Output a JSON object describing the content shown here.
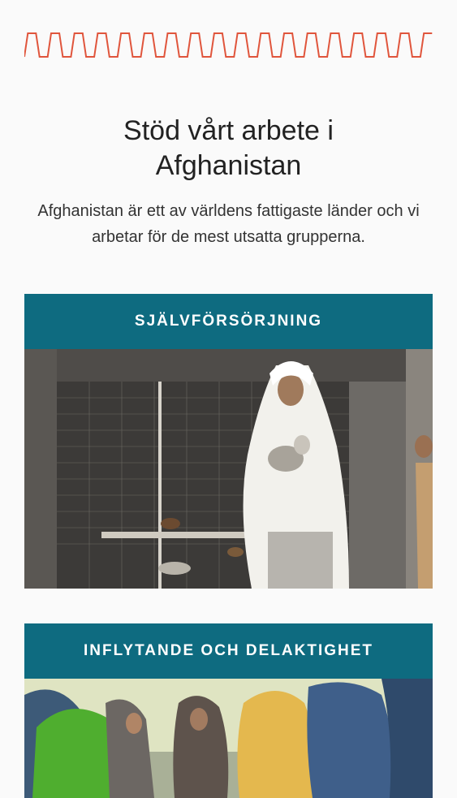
{
  "header": {
    "title_line1": "Stöd vårt arbete i",
    "title_line2": "Afghanistan",
    "intro": "Afghanistan är ett av världens fattigaste länder och vi arbetar för de mest utsatta grupperna.",
    "accent_color": "#e0553c"
  },
  "cards": [
    {
      "label": "SJÄLVFÖRSÖRJNING",
      "image_icon": "woman-holding-chicken-photo"
    },
    {
      "label": "INFLYTANDE OCH DELAKTIGHET",
      "image_icon": "women-meeting-photo"
    }
  ],
  "colors": {
    "card_header": "#0e6b80",
    "background": "#fafafa"
  }
}
